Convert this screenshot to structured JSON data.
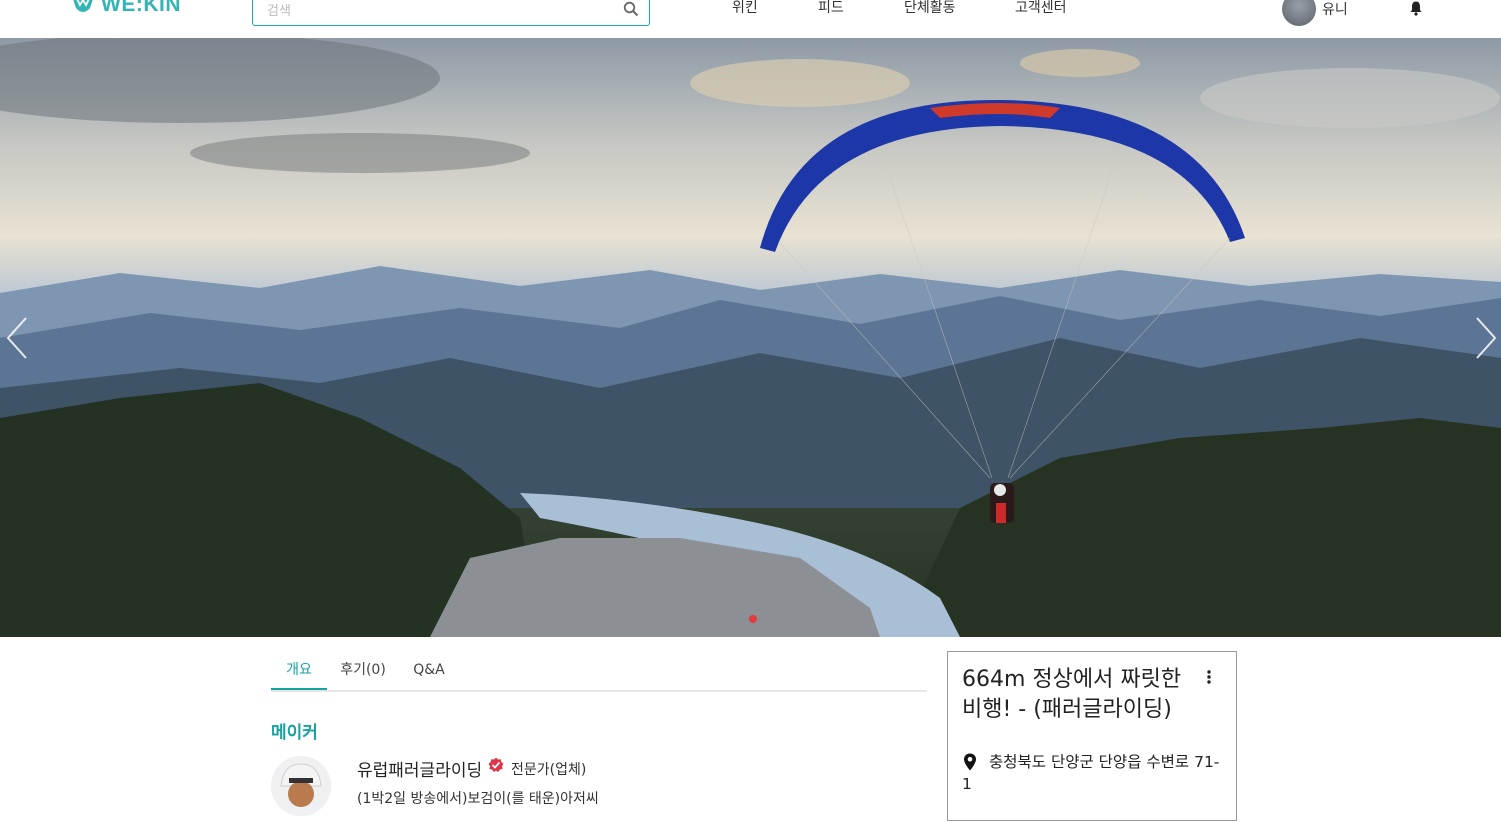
{
  "header": {
    "logo_text": "WE:KIN",
    "search": {
      "placeholder": "검색",
      "value": ""
    },
    "nav": [
      "위킨",
      "피드",
      "단체활동",
      "고객센터"
    ],
    "user_name": "유니",
    "icons": [
      "logo-icon",
      "search-icon",
      "avatar",
      "bell-icon"
    ]
  },
  "hero": {
    "icons": [
      "chevron-left-icon",
      "chevron-right-icon"
    ],
    "indicator_color": "#e23b3b"
  },
  "tabs": [
    {
      "label": "개요",
      "active": true
    },
    {
      "label": "후기(0)",
      "active": false
    },
    {
      "label": "Q&A",
      "active": false
    }
  ],
  "maker": {
    "section_title": "메이커",
    "name": "유럽패러글라이딩",
    "badge": "전문가(업체)",
    "description": "(1박2일 방송에서)보검이(를 태운)아저씨"
  },
  "card": {
    "title": "664m 정상에서 짜릿한 비행! - (패러글라이딩)",
    "address": "충청북도 단양군 단양읍 수변로 71-1"
  },
  "colors": {
    "accent": "#17a2a2",
    "verified": "#e0344a"
  }
}
